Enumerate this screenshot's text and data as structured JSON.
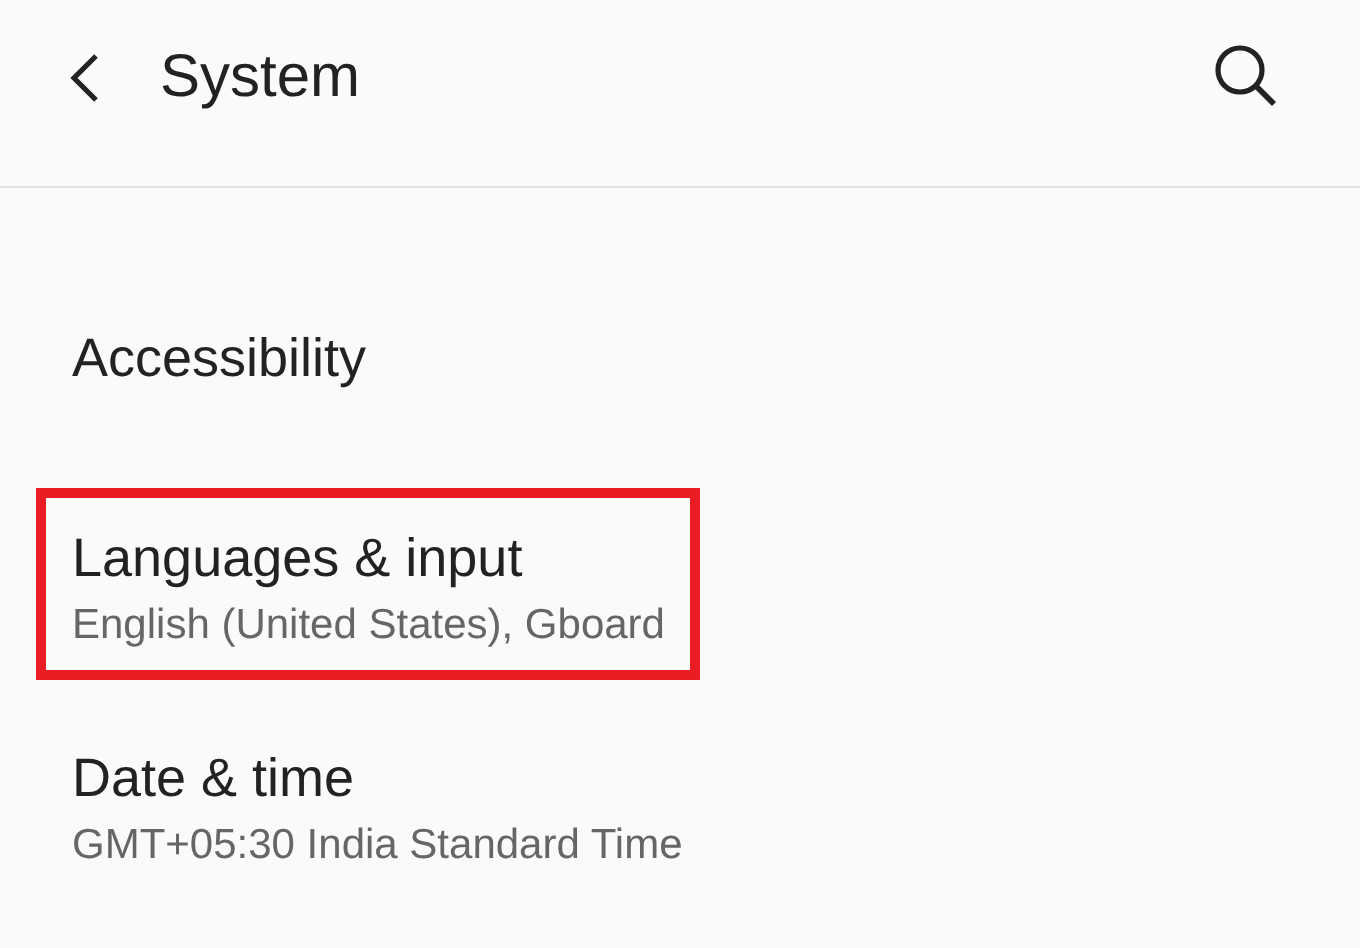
{
  "header": {
    "title": "System"
  },
  "items": [
    {
      "title": "Accessibility",
      "highlighted": false
    },
    {
      "title": "Languages & input",
      "summary": "English (United States), Gboard",
      "highlighted": true
    },
    {
      "title": "Date & time",
      "summary": "GMT+05:30 India Standard Time",
      "highlighted": false
    }
  ]
}
